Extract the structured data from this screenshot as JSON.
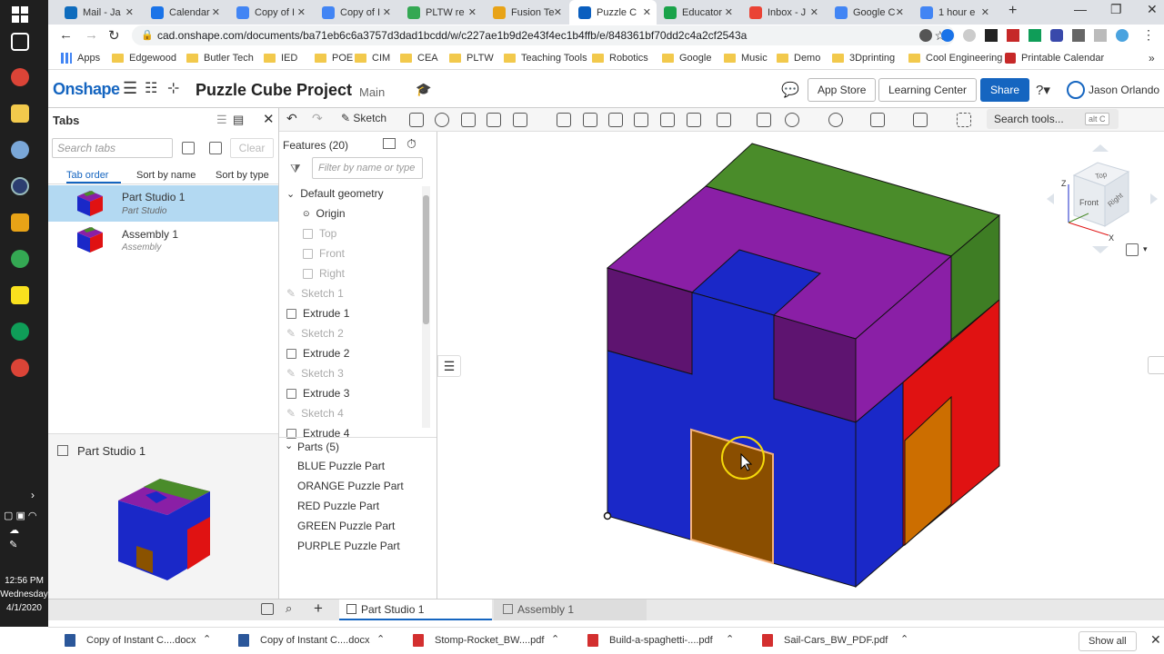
{
  "taskbar": {
    "time": "12:56 PM",
    "day": "Wednesday",
    "date": "4/1/2020"
  },
  "browser_tabs": [
    {
      "label": "Mail - Ja",
      "color": "#0f6cbd"
    },
    {
      "label": "Calendar",
      "color": "#1a73e8"
    },
    {
      "label": "Copy of I",
      "color": "#4285f4"
    },
    {
      "label": "Copy of I",
      "color": "#4285f4"
    },
    {
      "label": "PLTW re",
      "color": "#34a853"
    },
    {
      "label": "Fusion Te",
      "color": "#e8a317"
    },
    {
      "label": "Puzzle C",
      "color": "#0b5fbf"
    },
    {
      "label": "Educator",
      "color": "#1aa34a"
    },
    {
      "label": "Inbox - J",
      "color": "#ea4335"
    },
    {
      "label": "Google C",
      "color": "#4285f4"
    },
    {
      "label": "1 hour e",
      "color": "#4285f4"
    }
  ],
  "url": "cad.onshape.com/documents/ba71eb6c6a3757d3dad1bcdd/w/c227ae1b9d2e43f4ec1b4ffb/e/848361bf70dd2c4a2cf2543a",
  "bookmarks": [
    "Apps",
    "Edgewood",
    "Butler Tech",
    "IED",
    "POE",
    "CIM",
    "CEA",
    "PLTW",
    "Teaching Tools",
    "Robotics",
    "Google",
    "Music",
    "Demo",
    "3Dprinting",
    "Cool Engineering",
    "Printable Calendar"
  ],
  "header": {
    "logo": "Onshape",
    "doc_title": "Puzzle Cube Project",
    "branch": "Main",
    "app_store": "App Store",
    "learning_center": "Learning Center",
    "share": "Share",
    "user": "Jason Orlando"
  },
  "toolbar": {
    "sketch": "Sketch",
    "search": "Search tools...",
    "shortcut": "alt C"
  },
  "tabs_panel": {
    "title": "Tabs",
    "search_placeholder": "Search tabs",
    "clear": "Clear",
    "sort_tabs": [
      "Tab order",
      "Sort by name",
      "Sort by type"
    ],
    "items": [
      {
        "name": "Part Studio 1",
        "type": "Part Studio"
      },
      {
        "name": "Assembly 1",
        "type": "Assembly"
      }
    ],
    "preview_title": "Part Studio 1"
  },
  "features": {
    "title": "Features (20)",
    "filter_placeholder": "Filter by name or type",
    "default_geometry": "Default geometry",
    "geometry": [
      "Origin",
      "Top",
      "Front",
      "Right"
    ],
    "list": [
      "Sketch 1",
      "Extrude 1",
      "Sketch 2",
      "Extrude 2",
      "Sketch 3",
      "Extrude 3",
      "Sketch 4",
      "Extrude 4"
    ],
    "parts_title": "Parts (5)",
    "parts": [
      "BLUE Puzzle Part",
      "ORANGE Puzzle Part",
      "RED Puzzle Part",
      "GREEN Puzzle Part",
      "PURPLE Puzzle Part"
    ]
  },
  "viewcube": {
    "top": "Top",
    "front": "Front",
    "right": "Right",
    "z": "Z",
    "x": "X"
  },
  "bottom_tabs": [
    "Part Studio 1",
    "Assembly 1"
  ],
  "downloads": [
    "Copy of Instant C....docx",
    "Copy of Instant C....docx",
    "Stomp-Rocket_BW....pdf",
    "Build-a-spaghetti-....pdf",
    "Sail-Cars_BW_PDF.pdf"
  ],
  "show_all": "Show all",
  "colors": {
    "onshape_blue": "#1565c0",
    "selected_tab": "#b3d9f2",
    "green": "#4a8c2a",
    "purple": "#8a1fa6",
    "blue": "#1a28c8",
    "red": "#e01212",
    "orange": "#cc6e00"
  }
}
